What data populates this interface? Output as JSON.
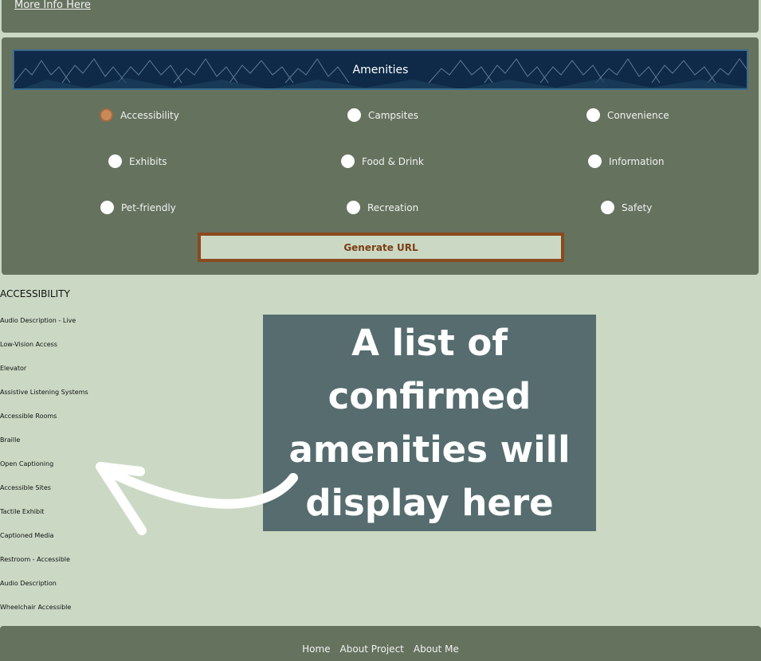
{
  "header": {
    "more_info_link": "More Info Here"
  },
  "amenities": {
    "title": "Amenities",
    "options": [
      {
        "label": "Accessibility",
        "selected": true
      },
      {
        "label": "Campsites",
        "selected": false
      },
      {
        "label": "Convenience",
        "selected": false
      },
      {
        "label": "Exhibits",
        "selected": false
      },
      {
        "label": "Food & Drink",
        "selected": false
      },
      {
        "label": "Information",
        "selected": false
      },
      {
        "label": "Pet-friendly",
        "selected": false
      },
      {
        "label": "Recreation",
        "selected": false
      },
      {
        "label": "Safety",
        "selected": false
      }
    ],
    "generate_button": "Generate URL"
  },
  "results": {
    "category_title": "ACCESSIBILITY",
    "items": [
      "Audio Description - Live",
      "Low-Vision Access",
      "Elevator",
      "Assistive Listening Systems",
      "Accessible Rooms",
      "Braille",
      "Open Captioning",
      "Accessible Sites",
      "Tactile Exhibit",
      "Captioned Media",
      "Restroom - Accessible",
      "Audio Description",
      "Wheelchair Accessible"
    ]
  },
  "callout": {
    "lines": [
      "A list of",
      "confirmed",
      "amenities will",
      "display here"
    ],
    "arrow_icon": "curved-arrow-icon"
  },
  "footer": {
    "links": [
      "Home",
      "About Project",
      "About Me"
    ]
  },
  "colors": {
    "background": "#cbd9c4",
    "panel": "#65725e",
    "banner": "#0e2a48",
    "accent": "#8a4a1e",
    "callout": "#566c6f"
  }
}
